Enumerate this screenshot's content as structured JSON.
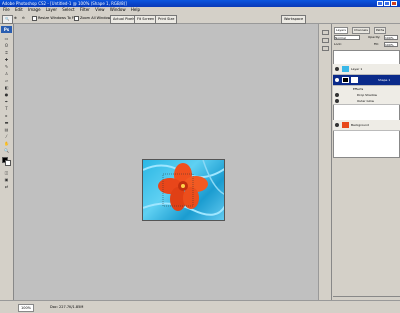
{
  "window": {
    "title": "Adobe Photoshop CS2 - [Untitled-1 @ 100% (Shape 1, RGB/8)]"
  },
  "menu": [
    "File",
    "Edit",
    "Image",
    "Layer",
    "Select",
    "Filter",
    "View",
    "Window",
    "Help"
  ],
  "options": {
    "resize_label": "Resize Windows To Fit",
    "zoom_all_label": "Zoom All Windows",
    "actual_pixels": "Actual Pixels",
    "fit_screen": "Fit Screen",
    "print_size": "Print Size",
    "workspace": "Workspace"
  },
  "layers_panel": {
    "tabs": [
      "Layers",
      "Channels",
      "Paths"
    ],
    "blend_mode": "Normal",
    "opacity_label": "Opacity:",
    "opacity_value": "100%",
    "fill_label": "Fill:",
    "fill_value": "100%",
    "lock_label": "Lock:",
    "layers": [
      {
        "name": "Layer 1"
      },
      {
        "name": "Background"
      },
      {
        "name": "Shape 1"
      },
      {
        "name": "Effects"
      },
      {
        "name": "Drop Shadow"
      },
      {
        "name": "Outer Glow"
      }
    ]
  },
  "status": {
    "zoom": "100%",
    "doc": "Doc: 227.7K/1.85M"
  },
  "colors": {
    "accent": "#0a3d91",
    "selected_layer": "#0a2a8a",
    "canvas_bg": "#c0c0c0"
  }
}
